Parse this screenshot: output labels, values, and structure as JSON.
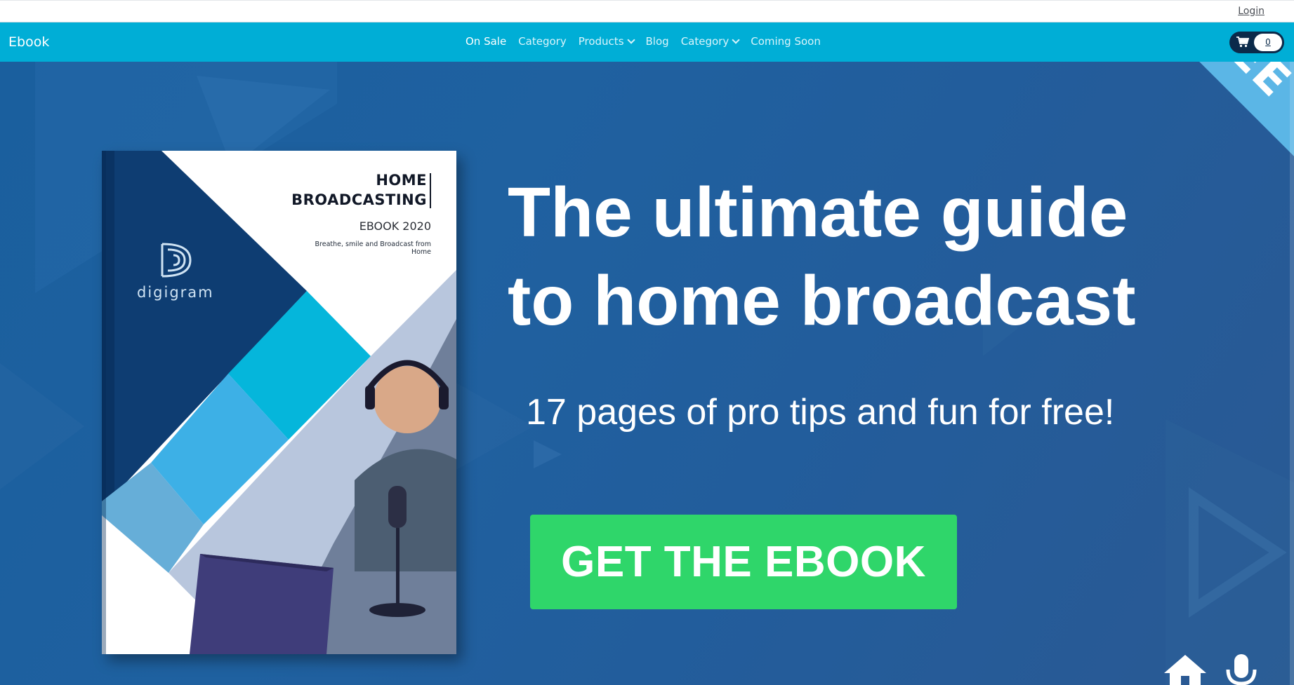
{
  "topbar": {
    "login_label": "Login"
  },
  "navbar": {
    "brand": "Ebook",
    "items": [
      {
        "label": "On Sale",
        "active": true,
        "dropdown": false
      },
      {
        "label": "Category",
        "active": false,
        "dropdown": false
      },
      {
        "label": "Products",
        "active": false,
        "dropdown": true
      },
      {
        "label": "Blog",
        "active": false,
        "dropdown": false
      },
      {
        "label": "Category",
        "active": false,
        "dropdown": true
      },
      {
        "label": "Coming Soon",
        "active": false,
        "dropdown": false
      }
    ],
    "cart": {
      "icon": "cart-icon",
      "count": "0"
    }
  },
  "hero": {
    "ribbon": "FREE",
    "headline_line1": "The ultimate guide",
    "headline_line2": "to home broadcast",
    "subhead": "17 pages of pro tips and fun for free!",
    "cta_label": "GET THE EBOOK",
    "book": {
      "title_line1": "HOME",
      "title_line2": "BROADCASTING",
      "edition": "EBOOK 2020",
      "tagline": "Breathe, smile and Broadcast from Home",
      "brand": "digigram"
    },
    "icons": [
      "home-icon",
      "microphone-icon"
    ]
  },
  "colors": {
    "navbar": "#00aed6",
    "hero_bg": "#1f61a0",
    "cta": "#2fd66a",
    "ribbon": "#5bb6e6",
    "cart_toggle": "#0b2a4a"
  }
}
